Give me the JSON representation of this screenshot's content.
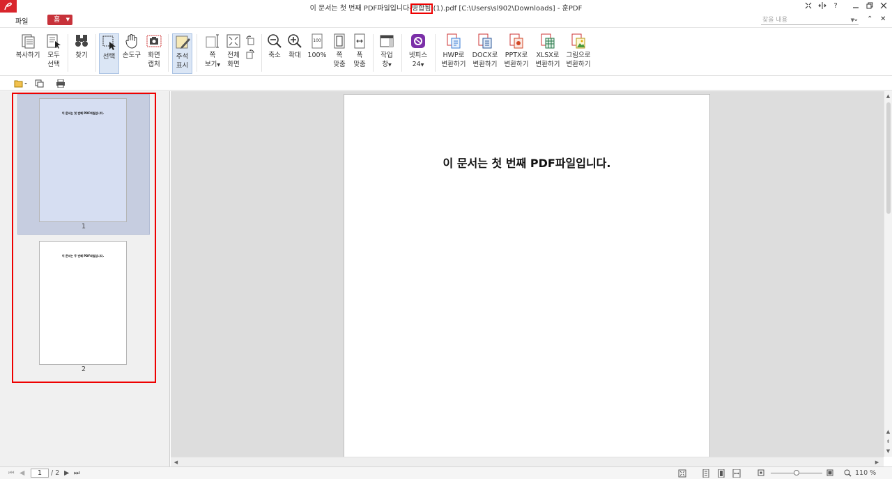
{
  "titlebar": {
    "title_before": "이 문서는 첫 번째 PDF파일입니다-",
    "title_highlight": "병합됨",
    "title_after": " (1).pdf [C:\\Users\\sl902\\Downloads] - 훈PDF",
    "help_label": "?"
  },
  "menu": {
    "file_label": "파일",
    "home_label": "홈",
    "search_placeholder": "찾을 내용"
  },
  "ribbon": {
    "copy": "복사하기",
    "select_all_1": "모두",
    "select_all_2": "선택",
    "find": "찾기",
    "select": "선택",
    "hand_tool": "손도구",
    "capture_1": "화면",
    "capture_2": "캡처",
    "annot_1": "주석",
    "annot_2": "표시",
    "width_view_1": "쪽",
    "width_view_2": "보기",
    "fullscreen_1": "전체",
    "fullscreen_2": "화면",
    "zoom_out": "축소",
    "zoom_in": "확대",
    "zoom_100": "100%",
    "zoom_100_icon_text": "100",
    "fit_page_1": "쪽",
    "fit_page_2": "맞춤",
    "fit_width_1": "폭",
    "fit_width_2": "맞춤",
    "workpane_1": "작업",
    "workpane_2": "창",
    "nexpis_1": "넷피스",
    "nexpis_2": "24",
    "hwp_1": "HWP로",
    "hwp_2": "변환하기",
    "docx_1": "DOCX로",
    "docx_2": "변환하기",
    "pptx_1": "PPTX로",
    "pptx_2": "변환하기",
    "xlsx_1": "XLSX로",
    "xlsx_2": "변환하기",
    "img_1": "그림으로",
    "img_2": "변환하기"
  },
  "thumbnails": [
    {
      "number": "1",
      "text": "이 문서는 첫 번째 PDF파일입니다.",
      "selected": true
    },
    {
      "number": "2",
      "text": "이 문서는 두 번째 PDF파일입니다.",
      "selected": false
    }
  ],
  "document": {
    "page_text": "이 문서는 첫 번째 PDF파일입니다."
  },
  "statusbar": {
    "current_page": "1",
    "total_pages": "/ 2",
    "zoom": "110 %"
  },
  "colors": {
    "accent": "#c7323a",
    "highlight_box": "#e00000",
    "selection": "#c6cde0"
  }
}
